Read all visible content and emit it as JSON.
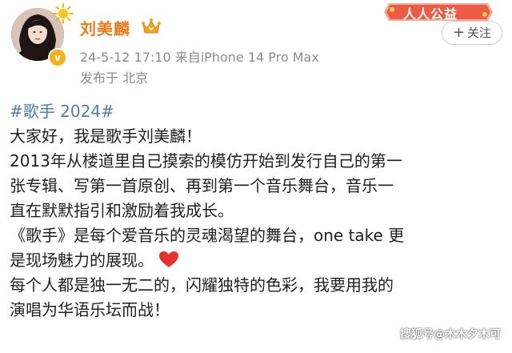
{
  "header": {
    "username": "刘美麟",
    "timestamp": "24-5-12 17:10",
    "source": "来自iPhone 14 Pro Max",
    "location": "发布于 北京",
    "fan_badge": "人人公益",
    "follow_label": "关注",
    "follow_plus": "+"
  },
  "post": {
    "hashtag": "#歌手 2024#",
    "lines": [
      "大家好，我是歌手刘美麟！",
      "2013年从楼道里自己摸索的模仿开始到发行自己的第一",
      "张专辑、写第一首原创、再到第一个音乐舞台，音乐一",
      "直在默默指引和激励着我成长。",
      "《歌手》是每个爱音乐的灵魂渴望的舞台，one take 更",
      "是现场魅力的展现。",
      "每个人都是独一无二的，闪耀独特的色彩，我要用我的",
      "演唱为华语乐坛而战！"
    ]
  },
  "watermark": "搜狐号@木木夕木可",
  "colors": {
    "username": "#ef7a1c",
    "hashtag": "#507daf",
    "meta": "#8c8c8c",
    "badge": "#f5b01c",
    "heart": "#e8312f"
  },
  "icons": {
    "avatar": "avatar",
    "sun": "sun-icon",
    "crown": "crown-icon",
    "verified": "verified-badge-icon",
    "heart": "heart-icon"
  }
}
